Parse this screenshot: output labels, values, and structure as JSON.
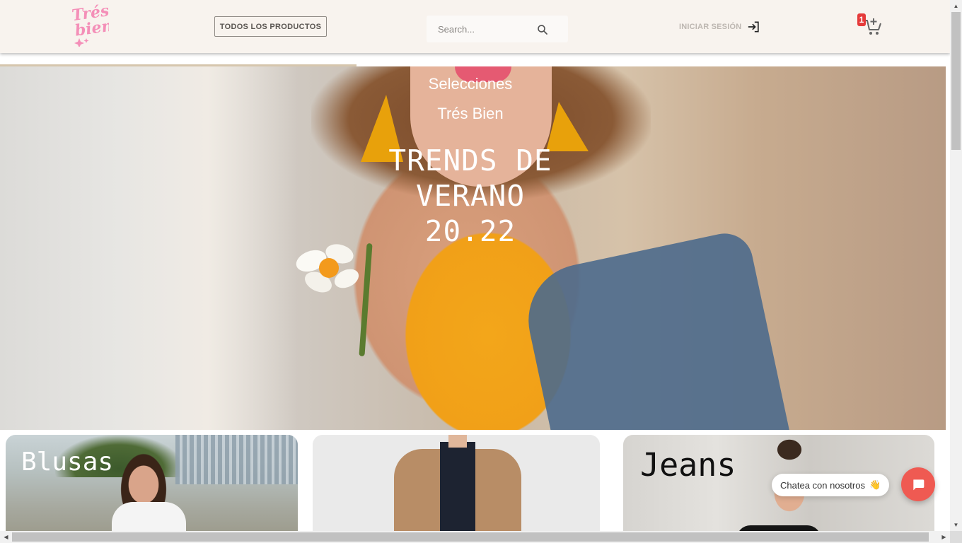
{
  "header": {
    "logo_text": "Trés bien",
    "all_products_label": "TODOS LOS PRODUCTOS",
    "search": {
      "placeholder": "Search...",
      "value": ""
    },
    "login_label": "INICIAR SESIÓN",
    "cart_count": "1"
  },
  "hero": {
    "subtitle_1": "Selecciones",
    "subtitle_2": "Trés Bien",
    "title_line_1": "TRENDS DE",
    "title_line_2": "VERANO",
    "title_line_3": "20.22"
  },
  "categories": [
    {
      "label": "Blusas"
    },
    {
      "label": ""
    },
    {
      "label": "Jeans"
    }
  ],
  "chat": {
    "bubble_text": "Chatea con nosotros",
    "bubble_emoji": "👋"
  },
  "colors": {
    "header_bg": "#f8f3ee",
    "logo_pink": "#f48fb8",
    "badge_red": "#e53a3a",
    "chat_button": "#ef5a52"
  },
  "icons": {
    "search": "search-icon",
    "login": "login-arrow-icon",
    "cart": "cart-plus-icon",
    "chat": "chat-bubble-icon"
  }
}
